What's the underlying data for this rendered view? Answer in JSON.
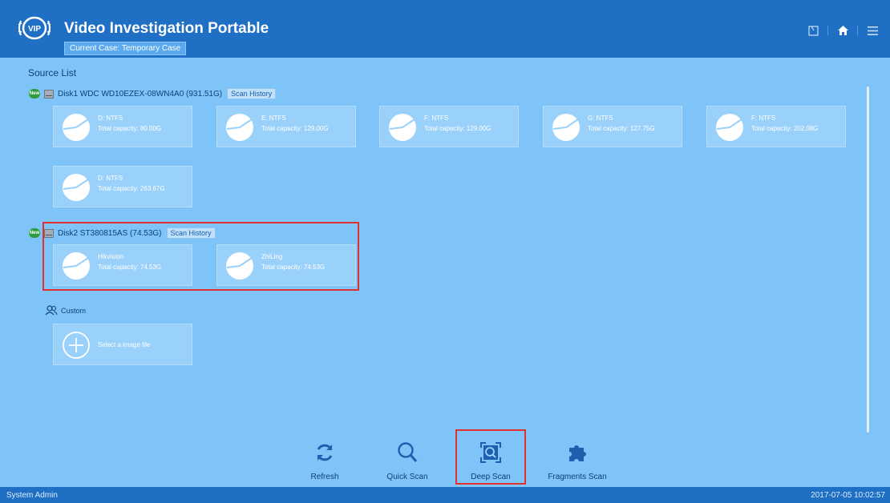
{
  "app": {
    "title": "Video Investigation Portable",
    "logo_text": "VIP",
    "current_case": "Current Case: Temporary Case"
  },
  "header_icons": [
    "export-icon",
    "home-icon",
    "menu-icon"
  ],
  "source_list": {
    "title": "Source List",
    "disks": [
      {
        "badge": "New",
        "label": "Disk1 WDC WD10EZEX-08WN4A0 (931.51G)",
        "scan_history": "Scan History",
        "partitions": [
          {
            "name": "D:  NTFS",
            "capacity": "Total capacity: 80.00G"
          },
          {
            "name": "E:  NTFS",
            "capacity": "Total capacity: 129.00G"
          },
          {
            "name": "F:  NTFS",
            "capacity": "Total capacity: 129.00G"
          },
          {
            "name": "G:  NTFS",
            "capacity": "Total capacity: 127.75G"
          },
          {
            "name": "F:  NTFS",
            "capacity": "Total capacity: 202.08G"
          },
          {
            "name": "D:  NTFS",
            "capacity": "Total capacity: 263.67G"
          }
        ]
      },
      {
        "badge": "New",
        "label": "Disk2 ST380815AS (74.53G)",
        "scan_history": "Scan History",
        "partitions": [
          {
            "name": "Hikvision",
            "capacity": "Total capacity: 74.53G"
          },
          {
            "name": "ZhiLing",
            "capacity": "Total capacity: 74.53G"
          }
        ]
      }
    ],
    "custom": {
      "label": "Custom",
      "select_label": "Select a image file"
    }
  },
  "toolbar": {
    "refresh": "Refresh",
    "quick_scan": "Quick Scan",
    "deep_scan": "Deep Scan",
    "fragments_scan": "Fragments Scan"
  },
  "status": {
    "user": "System Admin",
    "datetime": "2017-07-05 10:02:57"
  },
  "colors": {
    "header": "#1f6fc4",
    "background": "#7ec4f8",
    "card": "#9ad1fa",
    "highlight": "#e0312f",
    "new_badge": "#2f9d3b"
  }
}
